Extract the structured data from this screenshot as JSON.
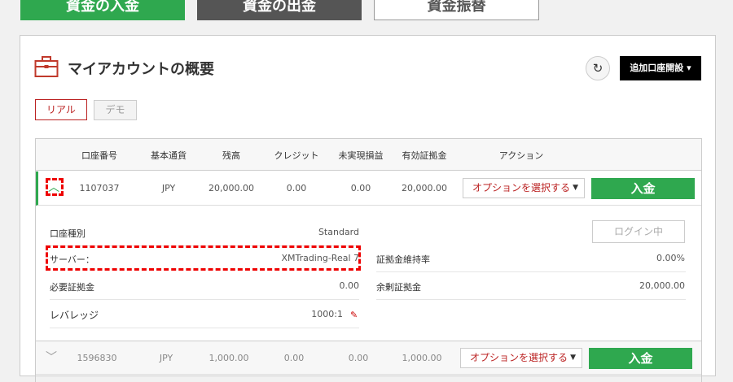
{
  "top_buttons": {
    "deposit": "資金の入金",
    "withdraw": "資金の出金",
    "transfer": "資金振替"
  },
  "header": {
    "title": "マイアカウントの概要",
    "refresh_icon": "↻",
    "add_account": "追加口座開設",
    "add_account_caret": "▾"
  },
  "tabs": {
    "real": "リアル",
    "demo": "デモ"
  },
  "table": {
    "headers": [
      "口座番号",
      "基本通貨",
      "残高",
      "クレジット",
      "未実現損益",
      "有効証拠金",
      "アクション"
    ],
    "rows": [
      {
        "account": "1107037",
        "currency": "JPY",
        "balance": "20,000.00",
        "credit": "0.00",
        "unrealized": "0.00",
        "equity": "20,000.00",
        "action_select": "オプションを選択する",
        "deposit": "入金",
        "chevron": "︿"
      },
      {
        "account": "1596830",
        "currency": "JPY",
        "balance": "1,000.00",
        "credit": "0.00",
        "unrealized": "0.00",
        "equity": "1,000.00",
        "action_select": "オプションを選択する",
        "deposit": "入金",
        "chevron": "﹀"
      }
    ],
    "select_caret": "▼"
  },
  "details": {
    "account_type_label": "口座種別",
    "account_type_value": "Standard",
    "server_label": "サーバー：",
    "server_value": "XMTrading-Real 7",
    "required_margin_label": "必要証拠金",
    "required_margin_value": "0.00",
    "leverage_label": "レバレッジ",
    "leverage_value": "1000:1",
    "margin_level_label": "証拠金維持率",
    "margin_level_value": "0.00%",
    "free_margin_label": "余剰証拠金",
    "free_margin_value": "20,000.00",
    "login_button": "ログイン中",
    "pencil_icon": "✎"
  },
  "colors": {
    "green": "#2fa84f",
    "red": "#bb2222",
    "highlight": "#ee0000"
  }
}
